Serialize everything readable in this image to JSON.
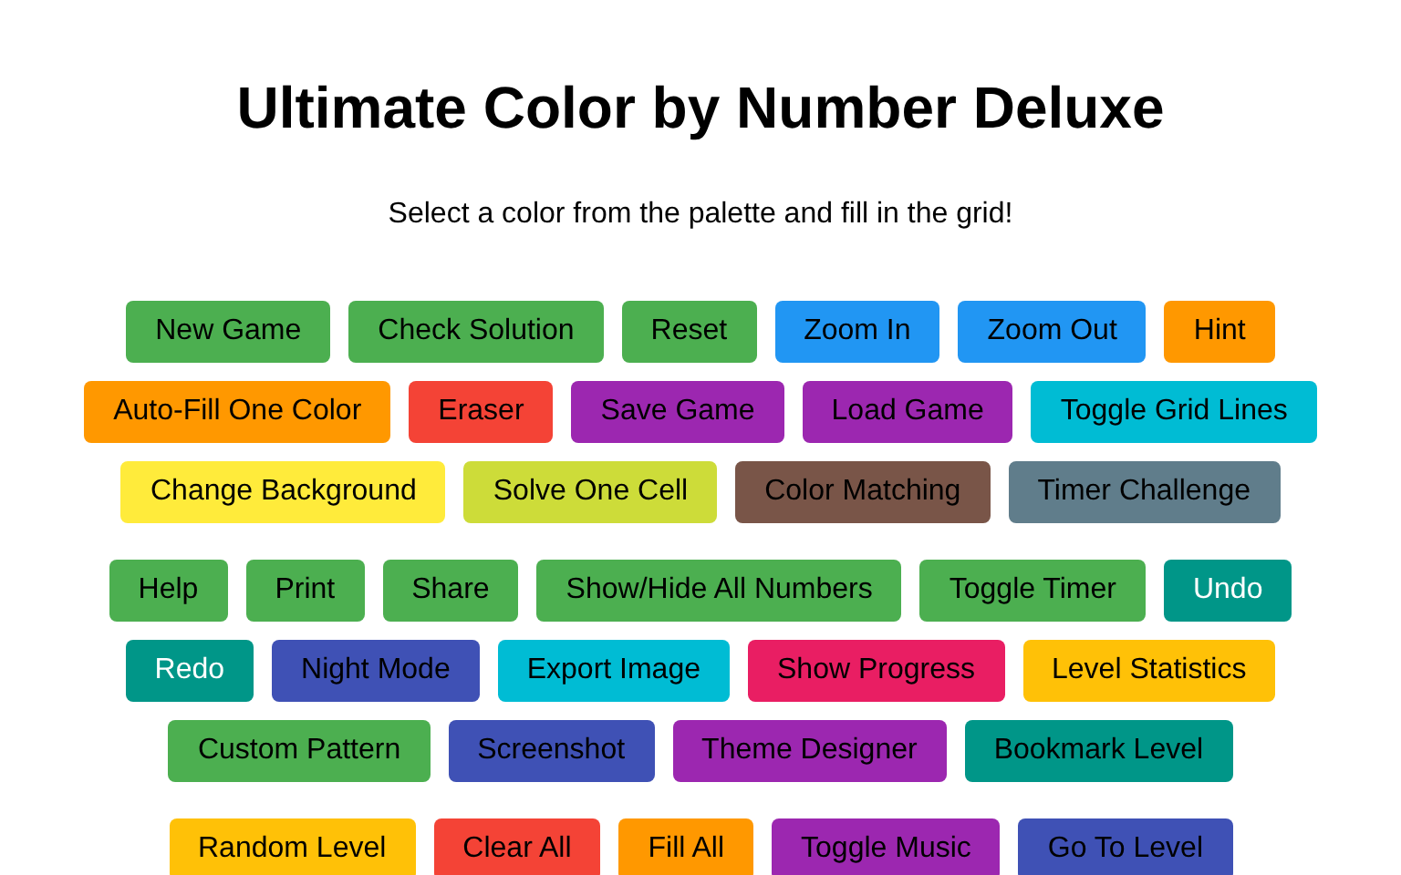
{
  "title": "Ultimate Color by Number Deluxe",
  "subtitle": "Select a color from the palette and fill in the grid!",
  "groups": [
    {
      "rows": [
        {
          "buttons": [
            {
              "label": "New Game",
              "color": "#4caf50",
              "inverted": false
            },
            {
              "label": "Check Solution",
              "color": "#4caf50",
              "inverted": false
            },
            {
              "label": "Reset",
              "color": "#4caf50",
              "inverted": false
            },
            {
              "label": "Zoom In",
              "color": "#2196f3",
              "inverted": false
            },
            {
              "label": "Zoom Out",
              "color": "#2196f3",
              "inverted": false
            },
            {
              "label": "Hint",
              "color": "#ff9800",
              "inverted": false
            }
          ]
        },
        {
          "buttons": [
            {
              "label": "Auto-Fill One Color",
              "color": "#ff9800",
              "inverted": false
            },
            {
              "label": "Eraser",
              "color": "#f44336",
              "inverted": false
            },
            {
              "label": "Save Game",
              "color": "#9c27b0",
              "inverted": false
            },
            {
              "label": "Load Game",
              "color": "#9c27b0",
              "inverted": false
            },
            {
              "label": "Toggle Grid Lines",
              "color": "#00bcd4",
              "inverted": false
            }
          ]
        },
        {
          "buttons": [
            {
              "label": "Change Background",
              "color": "#ffeb3b",
              "inverted": false
            },
            {
              "label": "Solve One Cell",
              "color": "#cddc39",
              "inverted": false
            },
            {
              "label": "Color Matching",
              "color": "#795548",
              "inverted": false
            },
            {
              "label": "Timer Challenge",
              "color": "#607d8b",
              "inverted": false
            }
          ]
        }
      ]
    },
    {
      "rows": [
        {
          "buttons": [
            {
              "label": "Help",
              "color": "#4caf50",
              "inverted": false
            },
            {
              "label": "Print",
              "color": "#4caf50",
              "inverted": false
            },
            {
              "label": "Share",
              "color": "#4caf50",
              "inverted": false
            },
            {
              "label": "Show/Hide All Numbers",
              "color": "#4caf50",
              "inverted": false
            },
            {
              "label": "Toggle Timer",
              "color": "#4caf50",
              "inverted": false
            },
            {
              "label": "Undo",
              "color": "#009688",
              "inverted": true
            }
          ]
        },
        {
          "buttons": [
            {
              "label": "Redo",
              "color": "#009688",
              "inverted": true
            },
            {
              "label": "Night Mode",
              "color": "#3f51b5",
              "inverted": false
            },
            {
              "label": "Export Image",
              "color": "#00bcd4",
              "inverted": false
            },
            {
              "label": "Show Progress",
              "color": "#e91e63",
              "inverted": false
            },
            {
              "label": "Level Statistics",
              "color": "#ffc107",
              "inverted": false
            }
          ]
        },
        {
          "buttons": [
            {
              "label": "Custom Pattern",
              "color": "#4caf50",
              "inverted": false
            },
            {
              "label": "Screenshot",
              "color": "#3f51b5",
              "inverted": false
            },
            {
              "label": "Theme Designer",
              "color": "#9c27b0",
              "inverted": false
            },
            {
              "label": "Bookmark Level",
              "color": "#009688",
              "inverted": false
            }
          ]
        }
      ]
    },
    {
      "rows": [
        {
          "buttons": [
            {
              "label": "Random Level",
              "color": "#ffc107",
              "inverted": false
            },
            {
              "label": "Clear All",
              "color": "#f44336",
              "inverted": false
            },
            {
              "label": "Fill All",
              "color": "#ff9800",
              "inverted": false
            },
            {
              "label": "Toggle Music",
              "color": "#9c27b0",
              "inverted": false
            },
            {
              "label": "Go To Level",
              "color": "#3f51b5",
              "inverted": false
            }
          ]
        }
      ]
    }
  ]
}
